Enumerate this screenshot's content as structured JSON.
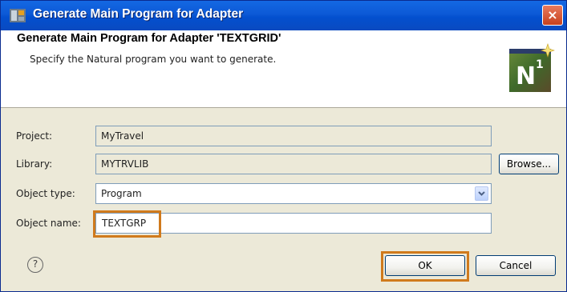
{
  "window": {
    "title": "Generate Main Program for Adapter",
    "close_glyph": "×"
  },
  "header": {
    "title": "Generate Main Program for Adapter 'TEXTGRID'",
    "description": "Specify the Natural program you want to generate.",
    "logo_text": "N",
    "logo_superscript": "1"
  },
  "form": {
    "project": {
      "label": "Project:",
      "value": "MyTravel"
    },
    "library": {
      "label": "Library:",
      "value": "MYTRVLIB",
      "browse_label": "Browse..."
    },
    "object_type": {
      "label": "Object type:",
      "value": "Program"
    },
    "object_name": {
      "label": "Object name:",
      "value": "TEXTGRP"
    }
  },
  "footer": {
    "help_glyph": "?",
    "ok_label": "OK",
    "cancel_label": "Cancel"
  },
  "colors": {
    "highlight": "#d07a1c",
    "titlebar": "#0a4ac0",
    "dialog_bg": "#ece9d8"
  },
  "icons": [
    "app-icon",
    "close-icon",
    "natural-logo-icon",
    "chevron-down-icon",
    "help-icon"
  ]
}
